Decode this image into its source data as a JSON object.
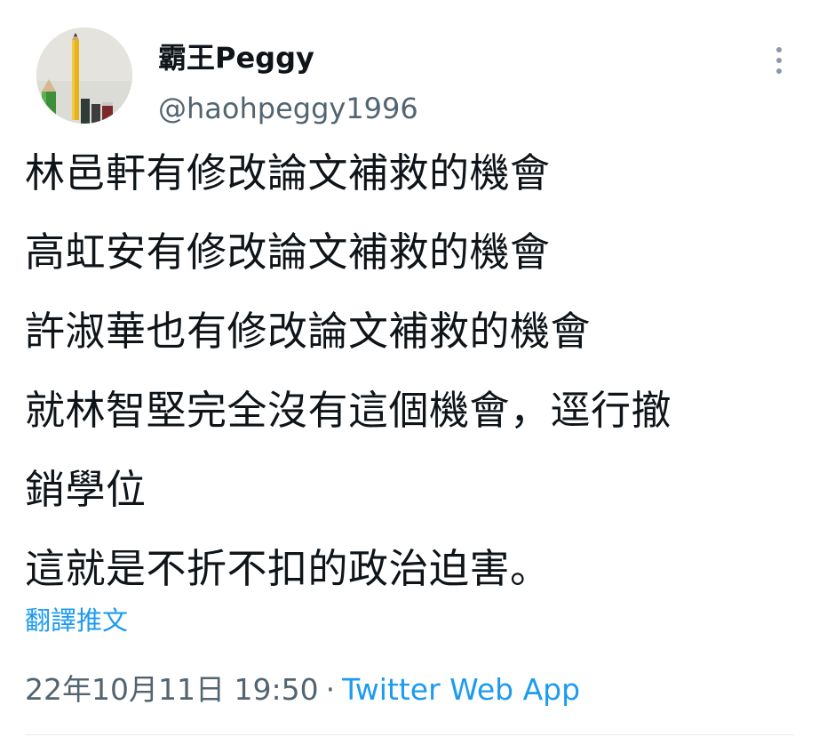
{
  "user": {
    "display_name": "霸王Peggy",
    "handle": "@haohpeggy1996",
    "avatar_icon": "pencils-avatar"
  },
  "more_icon": "more-vertical-icon",
  "tweet": {
    "lines": [
      "林邑軒有修改論文補救的機會",
      "高虹安有修改論文補救的機會",
      "許淑華也有修改論文補救的機會",
      "就林智堅完全沒有這個機會，逕行撤",
      "銷學位",
      "這就是不折不扣的政治迫害。"
    ],
    "translate_label": "翻譯推文",
    "timestamp": "22年10月11日 19:50",
    "separator": "·",
    "source": "Twitter Web App"
  },
  "colors": {
    "text": "#0f1419",
    "secondary": "#536471",
    "accent": "#1d9bf0"
  }
}
